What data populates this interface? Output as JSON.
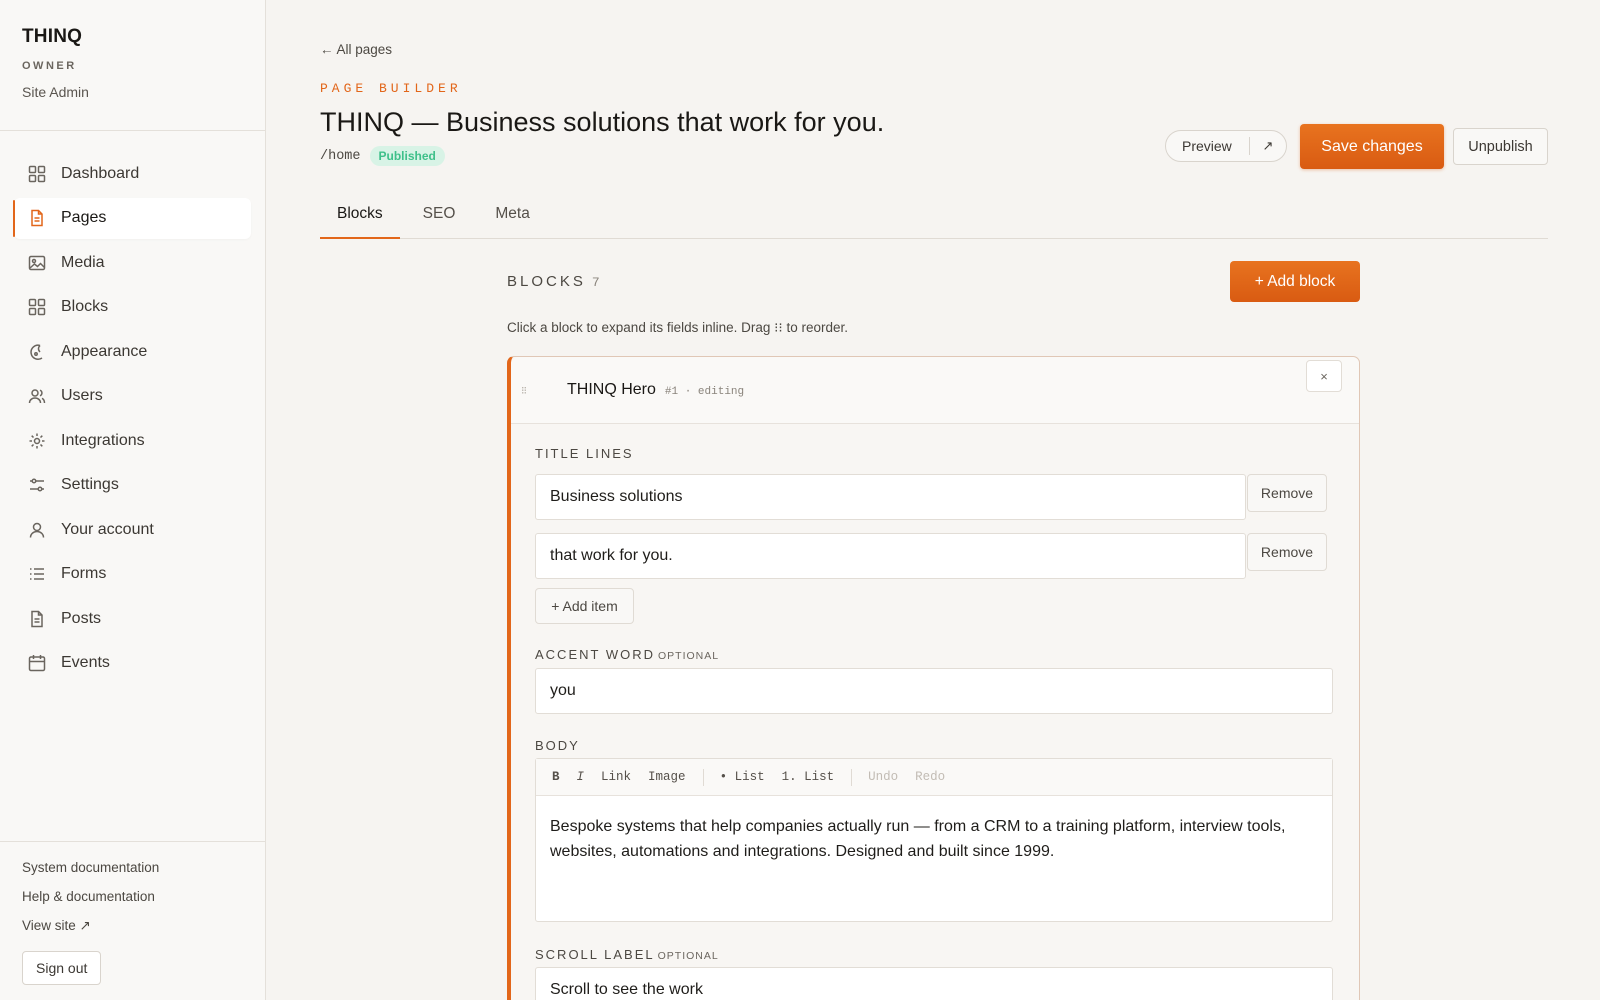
{
  "sidebar": {
    "brand": "THINQ",
    "role": "OWNER",
    "subtitle": "Site Admin",
    "items": [
      {
        "label": "Dashboard",
        "icon": "dashboard-grid-icon",
        "active": false
      },
      {
        "label": "Pages",
        "icon": "page-document-icon",
        "active": true
      },
      {
        "label": "Media",
        "icon": "image-icon",
        "active": false
      },
      {
        "label": "Blocks",
        "icon": "blocks-grid-icon",
        "active": false
      },
      {
        "label": "Appearance",
        "icon": "palette-icon",
        "active": false
      },
      {
        "label": "Users",
        "icon": "users-icon",
        "active": false
      },
      {
        "label": "Integrations",
        "icon": "integrations-sun-icon",
        "active": false
      },
      {
        "label": "Settings",
        "icon": "sliders-icon",
        "active": false
      },
      {
        "label": "Your account",
        "icon": "user-icon",
        "active": false
      },
      {
        "label": "Forms",
        "icon": "list-icon",
        "active": false
      },
      {
        "label": "Posts",
        "icon": "post-document-icon",
        "active": false
      },
      {
        "label": "Events",
        "icon": "calendar-icon",
        "active": false
      }
    ],
    "footer": {
      "system_docs": "System documentation",
      "help_docs": "Help & documentation",
      "view_site": "View site ↗",
      "sign_out": "Sign out"
    }
  },
  "header": {
    "back_link": "← All pages",
    "eyebrow": "PAGE BUILDER",
    "title": "THINQ — Business solutions that work for you.",
    "slug": "/home",
    "status": "Published",
    "preview_label": "Preview",
    "preview_external": "↗",
    "save_label": "Save changes",
    "unpublish_label": "Unpublish"
  },
  "tabs": [
    {
      "label": "Blocks",
      "active": true
    },
    {
      "label": "SEO",
      "active": false
    },
    {
      "label": "Meta",
      "active": false
    }
  ],
  "blocks": {
    "label": "BLOCKS",
    "count": "7",
    "add_label": "+ Add block",
    "hint": "Click a block to expand its fields inline. Drag ⁝⁝ to reorder.",
    "card": {
      "title": "THINQ Hero",
      "meta": "#1 · editing",
      "close": "×",
      "title_lines_label": "TITLE LINES",
      "title_lines": [
        "Business solutions",
        "that work for you."
      ],
      "remove_label": "Remove",
      "add_item_label": "+ Add item",
      "accent_label": "ACCENT WORD",
      "optional": "OPTIONAL",
      "accent_value": "you",
      "body_label": "BODY",
      "toolbar": {
        "bold": "B",
        "italic": "I",
        "link": "Link",
        "image": "Image",
        "bullet_list": "• List",
        "numbered_list": "1. List",
        "undo": "Undo",
        "redo": "Redo"
      },
      "body_text": "Bespoke systems that help companies actually run — from a CRM to a training platform, interview tools, websites, automations and integrations. Designed and built since 1999.",
      "scroll_label": "SCROLL LABEL",
      "scroll_value": "Scroll to see the work"
    }
  },
  "colors": {
    "accent": "#e2661a",
    "published_bg": "#d8f3e6",
    "published_text": "#3fc08a"
  }
}
